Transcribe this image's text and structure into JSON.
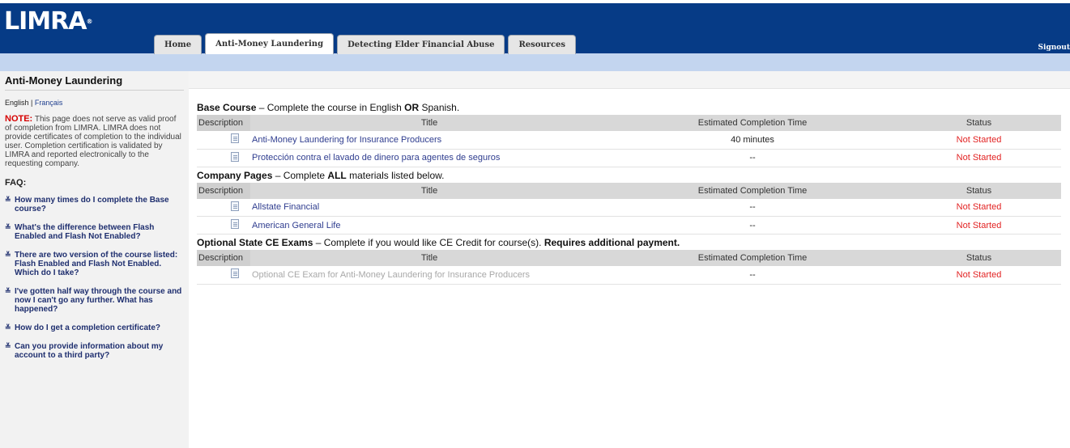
{
  "header": {
    "logo_text": "LIMRA",
    "logo_reg": "®",
    "tabs": [
      {
        "label": "Home"
      },
      {
        "label": "Anti-Money Laundering"
      },
      {
        "label": "Detecting Elder Financial Abuse"
      },
      {
        "label": "Resources"
      }
    ],
    "active_tab": "Anti-Money Laundering",
    "signout_label": "Signout"
  },
  "sidebar": {
    "title": "Anti-Money Laundering",
    "languages": {
      "english": "English",
      "separator": " | ",
      "french": "Français"
    },
    "note_label": "NOTE:",
    "note_text": " This page does not serve as valid proof of completion from LIMRA. LIMRA does not provide certificates of completion to the individual user. Completion certification is validated by LIMRA and reported electronically to the requesting company.",
    "faq_title": "FAQ:",
    "faq": [
      {
        "q": "How many times do I complete the Base course?"
      },
      {
        "q": "What's the difference between Flash Enabled and Flash Not Enabled?"
      },
      {
        "q": "There are two version of the course listed: Flash Enabled and Flash Not Enabled. Which do I take?"
      },
      {
        "q": "I've gotten half way through the course and now I can't go any further. What has happened?"
      },
      {
        "q": "How do I get a completion certificate?"
      },
      {
        "q": "Can you provide information about my account to a third party?"
      }
    ]
  },
  "columns": {
    "description": "Description",
    "title": "Title",
    "time": "Estimated Completion Time",
    "status": "Status"
  },
  "sections": {
    "base": {
      "heading": "Base Course",
      "text1": " – Complete the course in English ",
      "bold": "OR",
      "text2": " Spanish.",
      "rows": [
        {
          "title": "Anti-Money Laundering for Insurance Producers",
          "time": "40 minutes",
          "status": "Not Started"
        },
        {
          "title": "Protección contra el lavado de dinero para agentes de seguros",
          "time": "--",
          "status": "Not Started"
        }
      ]
    },
    "company": {
      "heading": "Company Pages",
      "text1": " – Complete ",
      "bold": "ALL",
      "text2": " materials listed below.",
      "rows": [
        {
          "title": "Allstate Financial",
          "time": "--",
          "status": "Not Started"
        },
        {
          "title": "American General Life",
          "time": "--",
          "status": "Not Started"
        }
      ]
    },
    "optional": {
      "heading": "Optional State CE Exams",
      "text1": " – Complete if you would like CE Credit for course(s). ",
      "bold": "Requires additional payment.",
      "text2": "",
      "rows": [
        {
          "title": "Optional CE Exam for Anti-Money Laundering for Insurance Producers",
          "time": "--",
          "status": "Not Started"
        }
      ]
    }
  },
  "colors": {
    "header": "#063b86",
    "subbar": "#c3d5ef",
    "status": "#e22222",
    "link": "#2f3d8f"
  },
  "icons": {
    "row_icon": "document-icon",
    "faq_icon": "chevron-double-down-icon"
  }
}
